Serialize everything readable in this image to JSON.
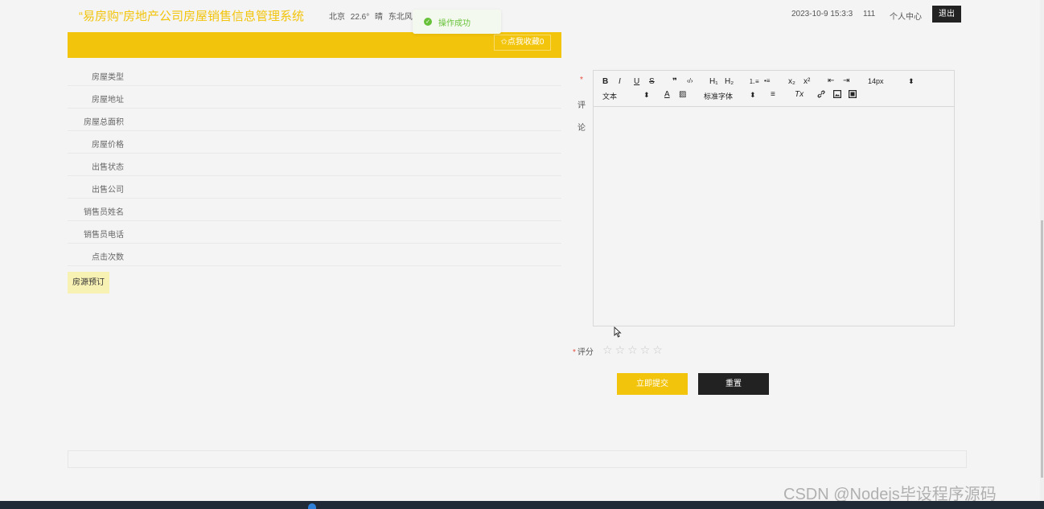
{
  "header": {
    "site_title": "“易房购”房地产公司房屋销售信息管理系统",
    "weather": {
      "city": "北京",
      "temperature": "22.6°",
      "condition": "晴",
      "wind": "东北风 2"
    },
    "datetime": "2023-10-9 15:3:3",
    "user_id": "111",
    "personal_center": "个人中心",
    "logout": "退出"
  },
  "toast": {
    "message": "操作成功",
    "color": "#67c23a"
  },
  "detail": {
    "favorite_button": "✩点我收藏0",
    "fields": [
      {
        "label": "房屋类型"
      },
      {
        "label": "房屋地址"
      },
      {
        "label": "房屋总面积"
      },
      {
        "label": "房屋价格"
      },
      {
        "label": "出售状态"
      },
      {
        "label": "出售公司"
      },
      {
        "label": "销售员姓名"
      },
      {
        "label": "销售员电话"
      },
      {
        "label": "点击次数"
      }
    ],
    "book_button": "房源预订"
  },
  "form": {
    "comment_required": "*",
    "comment_label_1": "评",
    "comment_label_2": "论",
    "toolbar": {
      "bold": "B",
      "italic": "I",
      "underline": "U",
      "strike": "S",
      "quote": "❞",
      "code": "‹/›",
      "h1": "H₁",
      "h2": "H₂",
      "ordered_list": "⒈≡",
      "bullet_list": "•≡",
      "subscript": "x₂",
      "superscript": "x²",
      "outdent": "⇤",
      "indent": "⇥",
      "size": "14px",
      "header_select": "文本",
      "color": "A",
      "background": "▨",
      "font_select": "标准字体",
      "align": "≡",
      "clean": "Tx",
      "link": "🔗",
      "image": "▣",
      "video": "▤"
    },
    "score_required": "*",
    "score_label": "评分",
    "rating": 0,
    "max_rating": 5,
    "submit": "立即提交",
    "reset": "重置"
  },
  "watermark": "CSDN @Nodejs毕设程序源码",
  "colors": {
    "brand_yellow": "#f2c40c",
    "dark": "#222222",
    "success": "#67c23a"
  }
}
